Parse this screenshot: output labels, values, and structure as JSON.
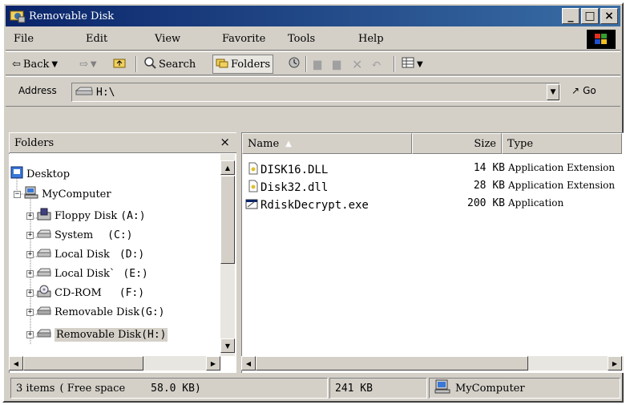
{
  "window": {
    "title": "Removable Disk"
  },
  "title_buttons": {
    "minimize": "_",
    "maximize": "□",
    "close": "×"
  },
  "menu": [
    "File",
    "Edit",
    "View",
    "Favorite",
    "Tools",
    "Help"
  ],
  "toolbar": {
    "back": "Back",
    "search": "Search",
    "folders": "Folders"
  },
  "address": {
    "label": "Address",
    "value": "H:\\",
    "go": "Go"
  },
  "folders_pane": {
    "title": "Folders",
    "close": "×",
    "tree": [
      {
        "label": "Desktop",
        "drive": ""
      },
      {
        "label": "MyComputer",
        "drive": ""
      },
      {
        "label": "Floppy Disk",
        "drive": "(A:)"
      },
      {
        "label": "System",
        "drive": "(C:)"
      },
      {
        "label": "Local Disk",
        "drive": "(D:)"
      },
      {
        "label": "Local Disk`",
        "drive": "(E:)"
      },
      {
        "label": "CD-ROM",
        "drive": "(F:)"
      },
      {
        "label": "Removable Disk",
        "drive": "(G:)"
      },
      {
        "label": "Removable Disk",
        "drive": "(H:)"
      }
    ]
  },
  "files_pane": {
    "columns": {
      "name": "Name",
      "size": "Size",
      "type": "Type"
    },
    "rows": [
      {
        "name": "DISK16.DLL",
        "size": "14 KB",
        "type": "Application Extension",
        "icon": "dll-icon"
      },
      {
        "name": "Disk32.dll",
        "size": "28 KB",
        "type": "Application Extension",
        "icon": "dll-icon"
      },
      {
        "name": "RdiskDecrypt.exe",
        "size": "200 KB",
        "type": "Application",
        "icon": "exe-icon"
      }
    ]
  },
  "status": {
    "items": "3 items",
    "free_label": "( Free space",
    "free_value": "58.0 KB)",
    "total": "241 KB",
    "location": "MyComputer"
  },
  "colors": {
    "title_bar": "#0a246a",
    "chrome": "#d4d0c8"
  }
}
